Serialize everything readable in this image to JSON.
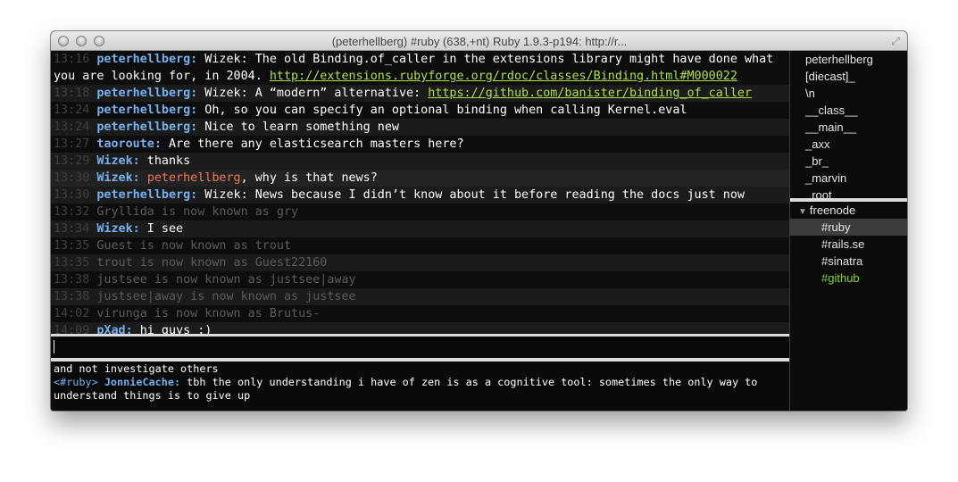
{
  "window": {
    "title": "(peterhellberg) #ruby (638,+nt) Ruby 1.9.3-p194: http://r..."
  },
  "messages": [
    {
      "time": "13:16",
      "nick": "peterhellberg:",
      "text": " Wizek: The old Binding.of_caller in the extensions library might have done what you are looking for, in 2004. ",
      "link": "http://extensions.rubyforge.org/rdoc/classes/Binding.html#M000022",
      "type": "nick"
    },
    {
      "time": "13:18",
      "nick": "peterhellberg:",
      "text": " Wizek: A “modern” alternative: ",
      "link": "https://github.com/banister/binding_of_caller",
      "type": "nick"
    },
    {
      "time": "13:24",
      "nick": "peterhellberg:",
      "text": " Oh, so you can specify an optional binding when calling Kernel.eval",
      "type": "nick"
    },
    {
      "time": "13:24",
      "nick": "peterhellberg:",
      "text": " Nice to learn something new",
      "type": "nick"
    },
    {
      "time": "13:27",
      "nick": "taoroute:",
      "text": " Are there any elasticsearch masters here?",
      "type": "nick"
    },
    {
      "time": "13:29",
      "nick": "Wizek:",
      "text": " thanks",
      "type": "nick"
    },
    {
      "time": "13:30",
      "nick": "Wizek:",
      "mention": "peterhellberg",
      "text": ", why is that news?",
      "type": "mention"
    },
    {
      "time": "13:30",
      "nick": "peterhellberg:",
      "text": " Wizek: News because I didn’t know about it before reading the docs just now",
      "type": "nick"
    },
    {
      "time": "13:32",
      "text": "Gryllida is now known as gry",
      "type": "event"
    },
    {
      "time": "13:34",
      "nick": "Wizek:",
      "text": " I see",
      "type": "nick"
    },
    {
      "time": "13:35",
      "text": "Guest is now known as trout",
      "type": "event"
    },
    {
      "time": "13:35",
      "text": "trout is now known as Guest22160",
      "type": "event"
    },
    {
      "time": "13:38",
      "text": "justsee is now known as justsee|away",
      "type": "event"
    },
    {
      "time": "13:38",
      "text": "justsee|away is now known as justsee",
      "type": "event"
    },
    {
      "time": "14:02",
      "text": "virunga is now known as Brutus-",
      "type": "event"
    },
    {
      "time": "14:09",
      "nick": "pXad:",
      "text": " hi guys :)",
      "type": "nick"
    }
  ],
  "input": {
    "value": ""
  },
  "console": {
    "line1": "and not investigate others",
    "channel": "<#ruby>",
    "nick": "JonnieCache:",
    "text": " tbh the only understanding i have of zen is as a cognitive tool: sometimes the only way to understand things is to give up"
  },
  "users": [
    "peterhellberg",
    "[diecast]_",
    "\\n",
    "__class__",
    "__main__",
    "_axx",
    "_br_",
    "_marvin",
    "_root"
  ],
  "server": {
    "name": "freenode",
    "channels": [
      {
        "name": "#ruby",
        "state": "selected"
      },
      {
        "name": "#rails.se",
        "state": "normal"
      },
      {
        "name": "#sinatra",
        "state": "normal"
      },
      {
        "name": "#github",
        "state": "highlight"
      }
    ]
  },
  "colors": {
    "nick": "#74b1ee",
    "link": "#b1df4d",
    "mention": "#f07a58",
    "event": "#5b5b5b",
    "highlight_channel": "#89d13a"
  }
}
